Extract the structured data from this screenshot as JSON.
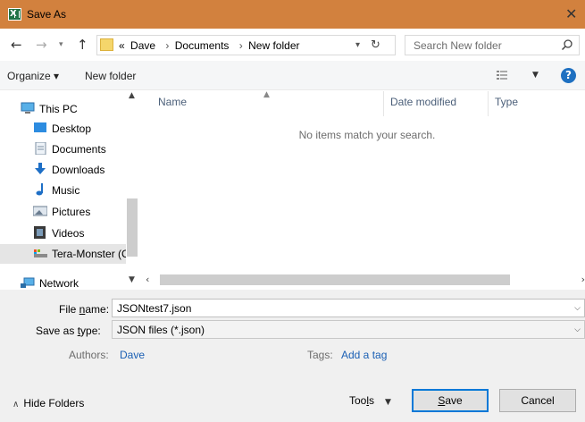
{
  "window": {
    "title": "Save As",
    "close_label": "✕"
  },
  "address": {
    "crumbs_prefix": "«",
    "crumbs": [
      "Dave",
      "Documents",
      "New folder"
    ]
  },
  "search": {
    "placeholder": "Search New folder"
  },
  "toolbar": {
    "organize_label": "Organize ▾",
    "new_folder_label": "New folder"
  },
  "nav_pane": {
    "items": [
      {
        "label": "This PC",
        "icon": "computer-icon"
      },
      {
        "label": "Desktop",
        "icon": "desktop-icon"
      },
      {
        "label": "Documents",
        "icon": "documents-icon"
      },
      {
        "label": "Downloads",
        "icon": "downloads-icon"
      },
      {
        "label": "Music",
        "icon": "music-icon"
      },
      {
        "label": "Pictures",
        "icon": "pictures-icon"
      },
      {
        "label": "Videos",
        "icon": "videos-icon"
      },
      {
        "label": "Tera-Monster (C",
        "icon": "drive-icon"
      },
      {
        "label": "Network",
        "icon": "network-icon"
      }
    ]
  },
  "file_list": {
    "columns": [
      "Name",
      "Date modified",
      "Type"
    ],
    "empty_message": "No items match your search."
  },
  "form": {
    "file_name_label_pre": "File ",
    "file_name_label_u": "n",
    "file_name_label_post": "ame:",
    "file_name_value": "JSONtest7.json",
    "save_type_label_pre": "Save as ",
    "save_type_label_u": "t",
    "save_type_label_post": "ype:",
    "save_type_value": "JSON files (*.json)",
    "authors_label": "Authors:",
    "authors_value": "Dave",
    "tags_label": "Tags:",
    "tags_value": "Add a tag"
  },
  "footer": {
    "hide_folders_label": "Hide Folders",
    "tools_pre": "Too",
    "tools_u": "l",
    "tools_post": "s",
    "save_u": "S",
    "save_post": "ave",
    "cancel_label": "Cancel"
  },
  "colors": {
    "titlebar": "#d2813e",
    "accent": "#0078d7",
    "link": "#1a5fb4"
  }
}
